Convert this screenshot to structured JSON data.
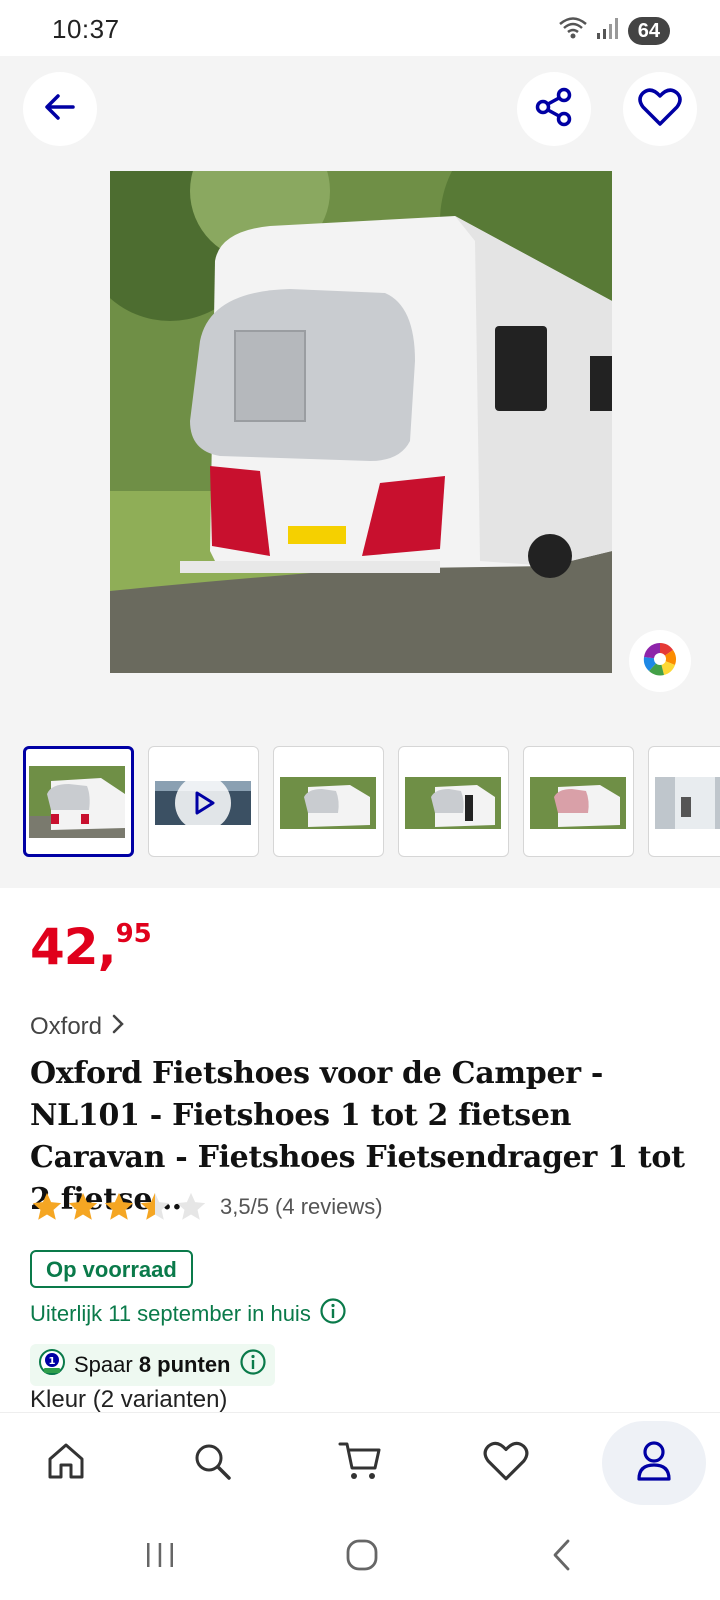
{
  "status_bar": {
    "time": "10:37",
    "battery": "64",
    "icons": [
      "wifi-icon",
      "signal-icon"
    ]
  },
  "gallery": {
    "back_icon": "arrow-left-icon",
    "share_icon": "share-icon",
    "favorite_icon": "heart-icon",
    "color_picker_icon": "color-wheel-icon",
    "thumbnail_count": 6,
    "active_thumbnail": 1
  },
  "product": {
    "price_main": "42,",
    "price_cents": "95",
    "brand": "Oxford",
    "title": "Oxford Fietshoes voor de Camper - NL101 - Fietshoes 1 tot 2 fietsen Caravan - Fietshoes Fietsendrager 1 tot 2 fietse…",
    "rating_value": 3.5,
    "rating_text": "3,5/5 (4 reviews)",
    "stock_label": "Op voorraad",
    "delivery_text": "Uiterlijk 11 september in huis",
    "points_prefix": "Spaar ",
    "points_bold": "8 punten",
    "variants_label": "Kleur (2 varianten)"
  },
  "colors": {
    "brand_blue": "#0000a4",
    "price_red": "#e0001b",
    "stock_green": "#0a7a4a",
    "star_yellow": "#f5a623"
  },
  "bottom_nav": {
    "items": [
      "home-icon",
      "search-icon",
      "cart-icon",
      "heart-icon",
      "account-icon"
    ],
    "active": "account-icon"
  },
  "system_nav": {
    "items": [
      "recents-icon",
      "home-circle-icon",
      "back-chevron-icon"
    ]
  }
}
